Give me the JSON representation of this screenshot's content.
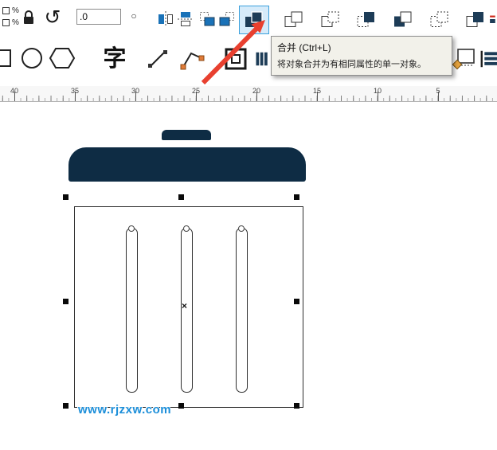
{
  "colors": {
    "navy": "#0e2c44",
    "icon_dark": "#1d3c57",
    "icon_blue": "#1a72b8",
    "highlight_bg": "#d6ebfa",
    "highlight_border": "#3aa0dc",
    "arrow_red": "#e8402f",
    "watermark_blue": "#1b8ed9"
  },
  "toolbar": {
    "scale_top_label": "%",
    "scale_bottom_label": "%",
    "rotate_glyph": "↺",
    "angle_value": ".0",
    "degree_symbol": "○"
  },
  "tooltip": {
    "title": "合并 (Ctrl+L)",
    "description": "将对象合并为有相同属性的单一对象。"
  },
  "tools": {
    "text_tool_label": "字"
  },
  "ruler": {
    "labels": [
      "40",
      "35",
      "30",
      "25",
      "20",
      "15",
      "10",
      "5"
    ]
  },
  "canvas": {
    "watermark": "www.rjzxw.com",
    "center_mark": "×"
  }
}
